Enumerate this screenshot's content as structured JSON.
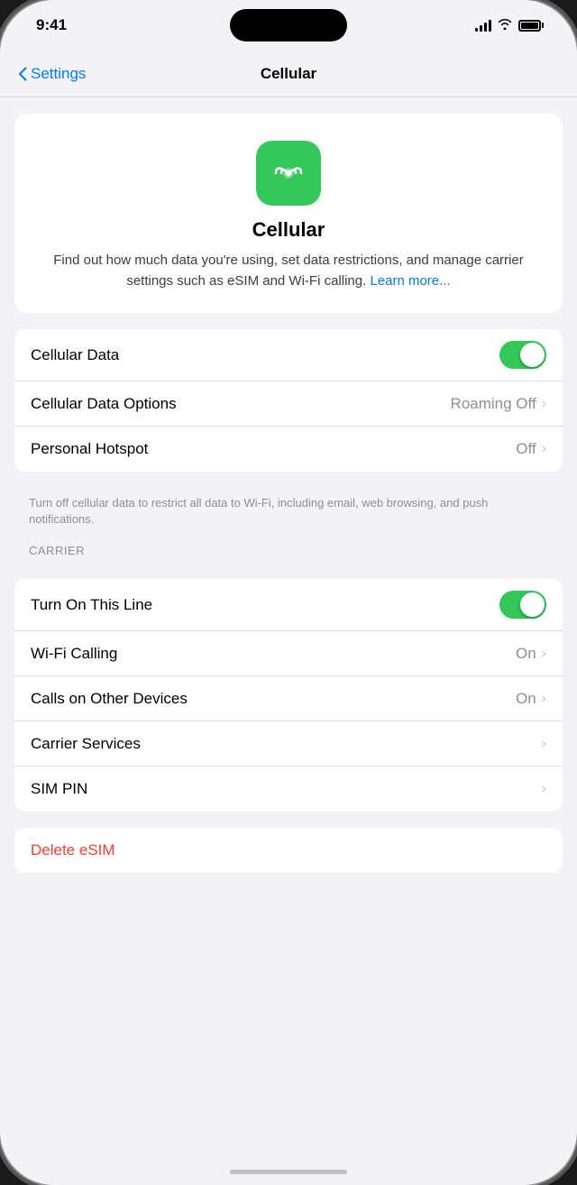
{
  "statusBar": {
    "time": "9:41"
  },
  "navBar": {
    "backLabel": "Settings",
    "title": "Cellular"
  },
  "heroCard": {
    "iconAlt": "cellular-signal-icon",
    "title": "Cellular",
    "description": "Find out how much data you're using, set data restrictions, and manage carrier settings such as eSIM and Wi-Fi calling.",
    "learnMore": "Learn more..."
  },
  "dataSection": {
    "rows": [
      {
        "id": "cellular-data",
        "label": "Cellular Data",
        "type": "toggle",
        "toggleOn": true
      },
      {
        "id": "cellular-data-options",
        "label": "Cellular Data Options",
        "type": "value-chevron",
        "value": "Roaming Off"
      },
      {
        "id": "personal-hotspot",
        "label": "Personal Hotspot",
        "type": "value-chevron",
        "value": "Off"
      }
    ],
    "caption": "Turn off cellular data to restrict all data to Wi-Fi, including email, web browsing, and push notifications."
  },
  "carrierSection": {
    "header": "CARRIER",
    "rows": [
      {
        "id": "turn-on-line",
        "label": "Turn On This Line",
        "type": "toggle",
        "toggleOn": true
      },
      {
        "id": "wifi-calling",
        "label": "Wi-Fi Calling",
        "type": "value-chevron",
        "value": "On"
      },
      {
        "id": "calls-other-devices",
        "label": "Calls on Other Devices",
        "type": "value-chevron",
        "value": "On"
      },
      {
        "id": "carrier-services",
        "label": "Carrier Services",
        "type": "chevron-only"
      },
      {
        "id": "sim-pin",
        "label": "SIM PIN",
        "type": "chevron-only"
      }
    ]
  },
  "deleteRow": {
    "label": "Delete eSIM"
  }
}
